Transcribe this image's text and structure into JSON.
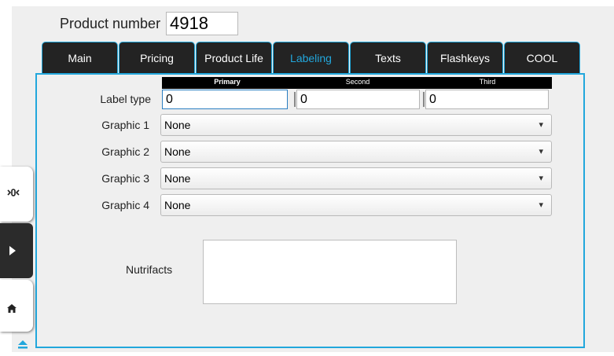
{
  "product": {
    "label": "Product number",
    "value": "4918"
  },
  "tabs": [
    {
      "label": "Main",
      "active": false
    },
    {
      "label": "Pricing",
      "active": false
    },
    {
      "label": "Product Life",
      "active": false
    },
    {
      "label": "Labeling",
      "active": true
    },
    {
      "label": "Texts",
      "active": false
    },
    {
      "label": "Flashkeys",
      "active": false
    },
    {
      "label": "COOL",
      "active": false
    }
  ],
  "label_type": {
    "label": "Label type",
    "headers": [
      "Primary",
      "Second",
      "Third"
    ],
    "values": [
      "0",
      "0",
      "0"
    ]
  },
  "graphics": [
    {
      "label": "Graphic 1",
      "value": "None"
    },
    {
      "label": "Graphic 2",
      "value": "None"
    },
    {
      "label": "Graphic 3",
      "value": "None"
    },
    {
      "label": "Graphic 4",
      "value": "None"
    }
  ],
  "nutrifacts": {
    "label": "Nutrifacts",
    "value": ""
  },
  "rail": {
    "icons": [
      "scale-icon",
      "play-icon",
      "home-icon",
      "eject-icon"
    ]
  },
  "colors": {
    "accent": "#22a7dc",
    "tab_bg": "#232323",
    "panel_bg": "#efefef"
  }
}
